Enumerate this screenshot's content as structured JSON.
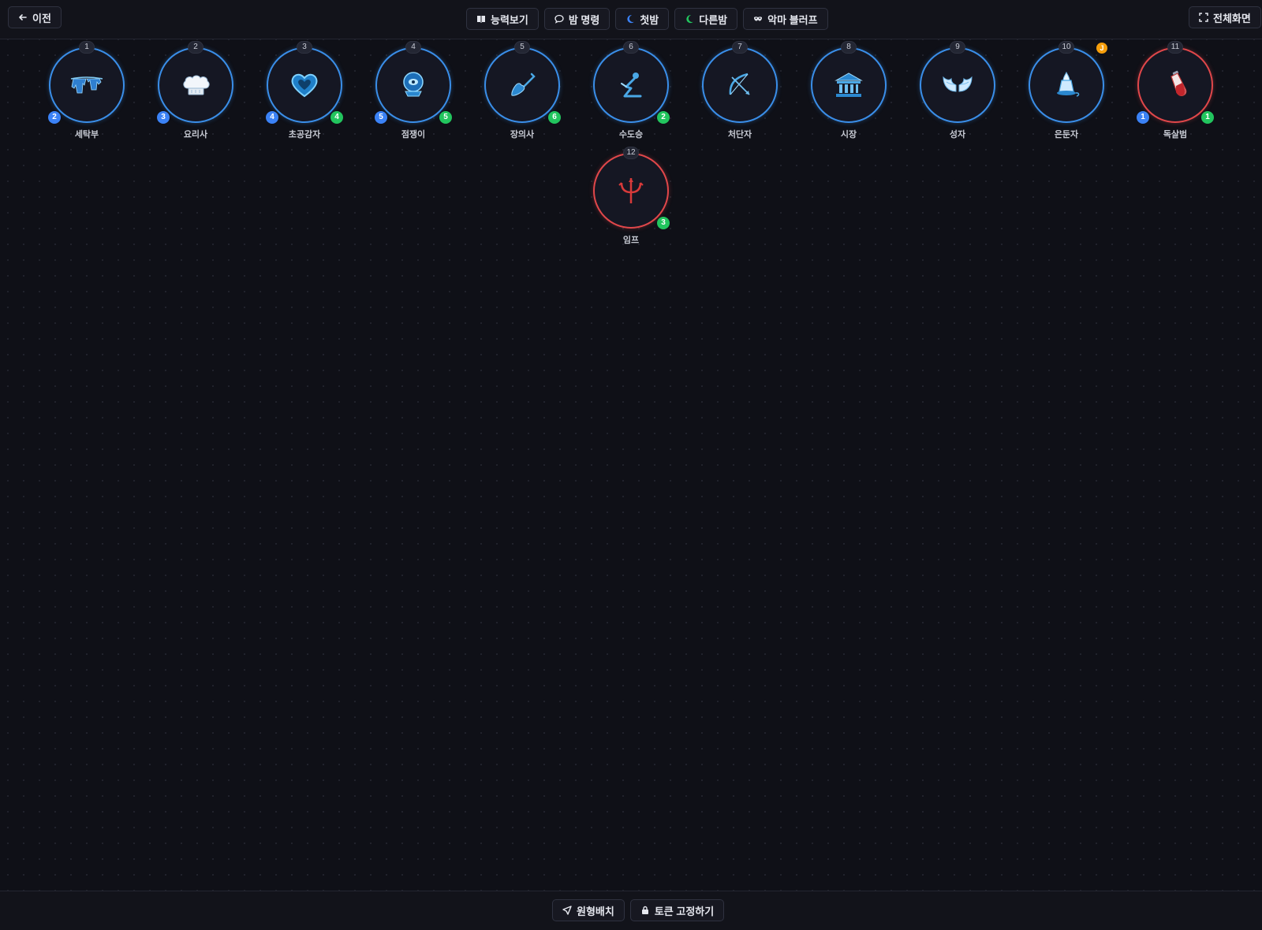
{
  "topbar": {
    "back_label": "이전",
    "abilities_label": "능력보기",
    "night_order_label": "밤 명령",
    "first_night_label": "첫밤",
    "other_nights_label": "다른밤",
    "demon_bluffs_label": "악마 블러프",
    "fullscreen_label": "전체화면"
  },
  "bottombar": {
    "circle_layout_label": "원형배치",
    "lock_tokens_label": "토큰 고정하기"
  },
  "colors": {
    "good": "#3a8ee8",
    "evil": "#e0474a",
    "badge_blue": "#3b82f6",
    "badge_green": "#22c55e",
    "badge_amber": "#f59e0b"
  },
  "tokens": [
    {
      "seat": "1",
      "name": "세탁부",
      "alignment": "good",
      "icon": "laundry-icon",
      "left_badge": "2"
    },
    {
      "seat": "2",
      "name": "요리사",
      "alignment": "good",
      "icon": "chef-hat-icon",
      "left_badge": "3"
    },
    {
      "seat": "3",
      "name": "초공감자",
      "alignment": "good",
      "icon": "heart-icon",
      "left_badge": "4",
      "right_badge": "4"
    },
    {
      "seat": "4",
      "name": "점쟁이",
      "alignment": "good",
      "icon": "crystal-ball-icon",
      "left_badge": "5",
      "right_badge": "5"
    },
    {
      "seat": "5",
      "name": "장의사",
      "alignment": "good",
      "icon": "shovel-icon",
      "right_badge": "6"
    },
    {
      "seat": "6",
      "name": "수도승",
      "alignment": "good",
      "icon": "monk-icon",
      "right_badge": "2"
    },
    {
      "seat": "7",
      "name": "처단자",
      "alignment": "good",
      "icon": "bow-icon"
    },
    {
      "seat": "8",
      "name": "시장",
      "alignment": "good",
      "icon": "town-hall-icon"
    },
    {
      "seat": "9",
      "name": "성자",
      "alignment": "good",
      "icon": "wings-icon"
    },
    {
      "seat": "10",
      "name": "은둔자",
      "alignment": "good",
      "icon": "lantern-icon",
      "top_badge": "J"
    },
    {
      "seat": "11",
      "name": "독살범",
      "alignment": "evil",
      "icon": "poison-vial-icon",
      "left_badge": "1",
      "right_badge": "1"
    },
    {
      "seat": "12",
      "name": "임프",
      "alignment": "evil",
      "icon": "trident-icon",
      "right_badge": "3"
    }
  ]
}
